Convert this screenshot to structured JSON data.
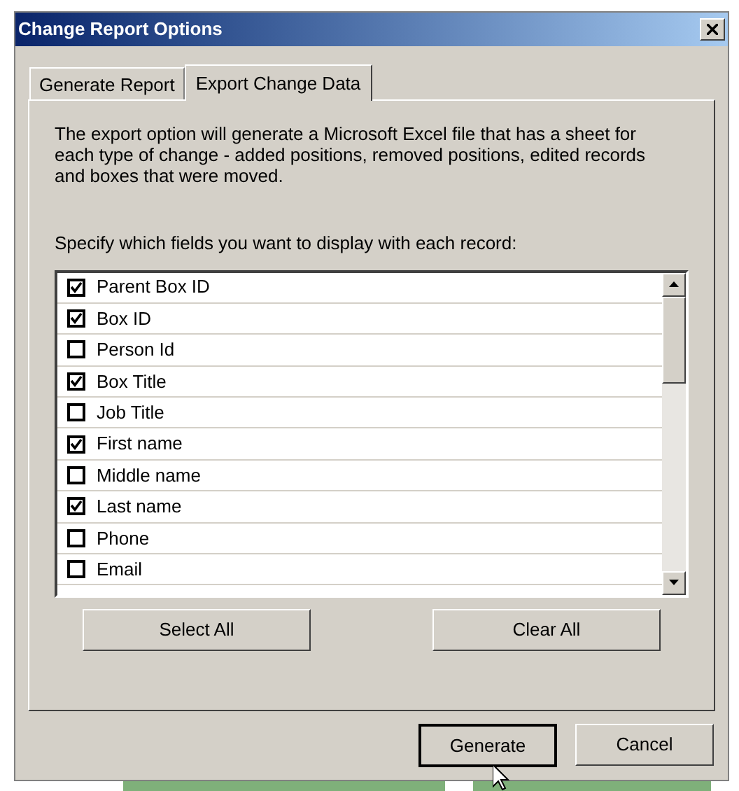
{
  "window": {
    "title": "Change Report Options"
  },
  "tabs": [
    {
      "label": "Generate Report",
      "selected": false
    },
    {
      "label": "Export Change Data",
      "selected": true
    }
  ],
  "description": "The export option will generate a Microsoft Excel file that has a sheet for each type of change - added positions, removed positions, edited records and boxes that were moved.",
  "fields_prompt": "Specify which fields you want to display with each record:",
  "fields": [
    {
      "label": "Parent Box ID",
      "checked": true
    },
    {
      "label": "Box ID",
      "checked": true
    },
    {
      "label": "Person Id",
      "checked": false
    },
    {
      "label": "Box Title",
      "checked": true
    },
    {
      "label": "Job Title",
      "checked": false
    },
    {
      "label": "First name",
      "checked": true
    },
    {
      "label": "Middle name",
      "checked": false
    },
    {
      "label": "Last name",
      "checked": true
    },
    {
      "label": "Phone",
      "checked": false
    },
    {
      "label": "Email",
      "checked": false
    }
  ],
  "list_buttons": [
    "Select All",
    "Clear All"
  ],
  "dialog_buttons": [
    {
      "label": "Generate",
      "default": true
    },
    {
      "label": "Cancel",
      "default": false
    }
  ]
}
